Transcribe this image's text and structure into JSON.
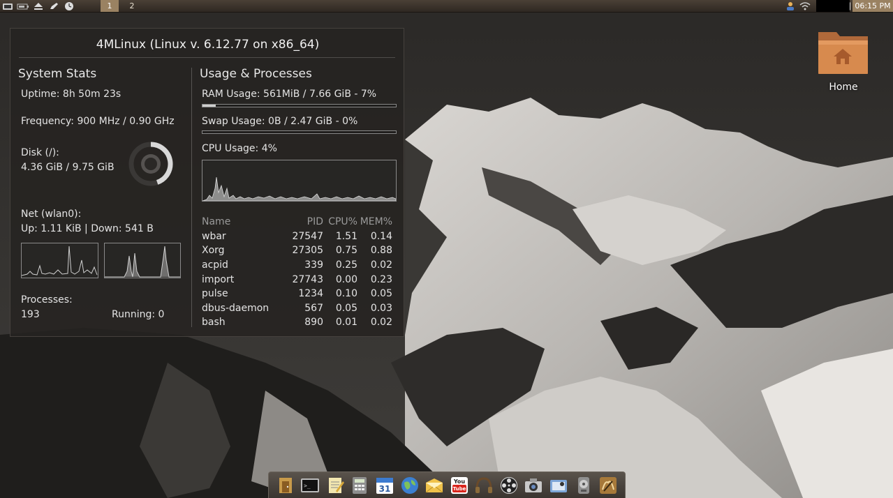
{
  "top_panel": {
    "workspaces": [
      "1",
      "2"
    ],
    "active_workspace": "1",
    "clock": "06:15 PM",
    "left_icons": [
      "terminal-icon",
      "battery-icon",
      "eject-icon",
      "pen-icon",
      "clock-widget-icon"
    ],
    "right_icons": [
      "user-icon",
      "wifi-icon",
      "paperclip-icon",
      "edit-icon",
      "volume-icon"
    ]
  },
  "conky": {
    "title": "4MLinux (Linux v. 6.12.77 on x86_64)",
    "system": {
      "heading": "System Stats",
      "uptime": "Uptime: 8h 50m 23s",
      "frequency": "Frequency: 900 MHz / 0.90 GHz",
      "disk_label": "Disk (/):",
      "disk_value": "4.36 GiB / 9.75 GiB",
      "disk_used_fraction": 0.447,
      "net_label": "Net (wlan0):",
      "net_value": "Up: 1.11 KiB | Down: 541 B",
      "processes_label": "Processes:",
      "processes_value": "193",
      "running": "Running: 0"
    },
    "usage": {
      "heading": "Usage & Processes",
      "ram": "RAM Usage: 561MiB / 7.66 GiB - 7%",
      "ram_fraction": 0.07,
      "swap": "Swap Usage: 0B / 2.47 GiB - 0%",
      "swap_fraction": 0.0,
      "cpu": "CPU Usage: 4%"
    },
    "process_table": {
      "headers": [
        "Name",
        "PID",
        "CPU%",
        "MEM%"
      ],
      "rows": [
        [
          "wbar",
          "27547",
          "1.51",
          "0.14"
        ],
        [
          "Xorg",
          "27305",
          "0.75",
          "0.88"
        ],
        [
          "acpid",
          "339",
          "0.25",
          "0.02"
        ],
        [
          "import",
          "27743",
          "0.00",
          "0.23"
        ],
        [
          "pulse",
          "1234",
          "0.10",
          "0.05"
        ],
        [
          "dbus-daemon",
          "567",
          "0.05",
          "0.03"
        ],
        [
          "bash",
          "890",
          "0.01",
          "0.02"
        ]
      ]
    }
  },
  "desktop": {
    "home_label": "Home"
  },
  "dock": {
    "items": [
      "file-manager-icon",
      "terminal-icon",
      "text-editor-icon",
      "calculator-icon",
      "calendar-icon",
      "web-browser-icon",
      "mail-icon",
      "youtube-icon",
      "headphones-icon",
      "video-player-icon",
      "camera-icon",
      "screenshot-icon",
      "disc-icon",
      "xfce-mouse-icon"
    ],
    "calendar_day": "31",
    "youtube_text": "You Tube"
  },
  "colors": {
    "accent": "#9a8262",
    "panel_bg": "#262321"
  }
}
